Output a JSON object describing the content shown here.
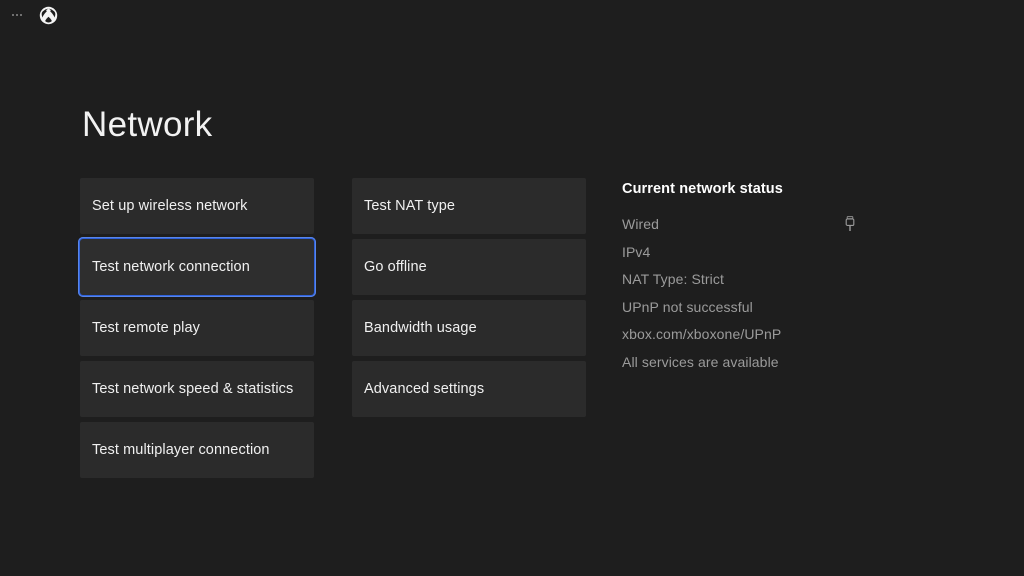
{
  "topbar": {
    "ellipsis_icon": "ellipsis-icon",
    "xbox_logo_icon": "xbox-logo-icon"
  },
  "page": {
    "title": "Network",
    "background_color": "#1e1e1e",
    "tile_color": "#2b2b2b",
    "focus_ring_color": "#2f62dc",
    "label_color": "#f0f0f0",
    "status_text_color": "#9b9b9b"
  },
  "columns": {
    "primary": [
      {
        "label": "Set up wireless network",
        "focused": false
      },
      {
        "label": "Test network connection",
        "focused": true
      },
      {
        "label": "Test remote play",
        "focused": false
      },
      {
        "label": "Test network speed & statistics",
        "focused": false
      },
      {
        "label": "Test multiplayer connection",
        "focused": false
      }
    ],
    "secondary": [
      {
        "label": "Test NAT type",
        "focused": false
      },
      {
        "label": "Go offline",
        "focused": false
      },
      {
        "label": "Bandwidth usage",
        "focused": false
      },
      {
        "label": "Advanced settings",
        "focused": false
      }
    ]
  },
  "status": {
    "heading": "Current network status",
    "rows": [
      {
        "text": "Wired",
        "icon": "ethernet-plug-icon"
      },
      {
        "text": "IPv4",
        "icon": null
      },
      {
        "text": "NAT Type: Strict",
        "icon": null
      },
      {
        "text": "UPnP not successful",
        "icon": null
      },
      {
        "text": "xbox.com/xboxone/UPnP",
        "icon": null
      },
      {
        "text": "All services are available",
        "icon": null
      }
    ]
  }
}
